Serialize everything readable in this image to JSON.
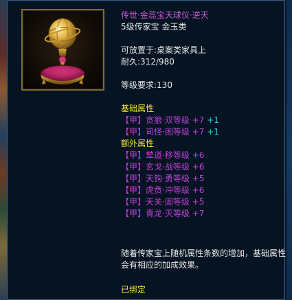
{
  "item": {
    "name": "传世·金蕊宝天球仪·逆天",
    "type_line": "5级传家宝 金玉类",
    "place": "可放置于:桌案类家具上",
    "durability": "耐久:312/980",
    "level_req": "等级要求:130",
    "icon": "golden-celestial-globe-icon"
  },
  "base_attrs": {
    "header": "基础属性",
    "items": [
      {
        "tag": "【甲】",
        "name": "贪狼·双等级",
        "value": "+7",
        "bonus": "+1"
      },
      {
        "tag": "【甲】",
        "name": "司怪·困等级",
        "value": "+7",
        "bonus": "+1"
      }
    ]
  },
  "extra_attrs": {
    "header": "额外属性",
    "items": [
      {
        "tag": "【甲】",
        "name": "辇道·移等级",
        "value": "+6"
      },
      {
        "tag": "【甲】",
        "name": "玄戈·战等级",
        "value": "+6"
      },
      {
        "tag": "【甲】",
        "name": "天钩·勇等级",
        "value": "+5"
      },
      {
        "tag": "【甲】",
        "name": "虎贲·冲等级",
        "value": "+6"
      },
      {
        "tag": "【甲】",
        "name": "天关·固等级",
        "value": "+5"
      },
      {
        "tag": "【甲】",
        "name": "青龙·灭等级",
        "value": "+7"
      }
    ]
  },
  "description": {
    "line1": "随着传家宝上随机属性条数的增加，基础属性",
    "line2": "会有相应的加成效果。"
  },
  "bound_text": "已绑定",
  "colors": {
    "title": "#c85cd6",
    "gold": "#f2e23a",
    "purple": "#c040d8",
    "cyan": "#27d4d4",
    "frame": "#7d6a3c"
  }
}
